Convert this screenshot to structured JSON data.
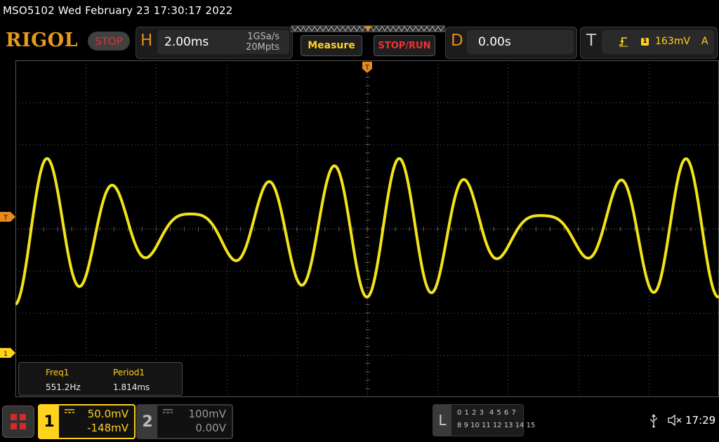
{
  "status_bar": {
    "text": "MSO5102  Wed February 23 17:30:17 2022"
  },
  "header": {
    "brand": "RIGOL",
    "run_state": "STOP",
    "horizontal": {
      "letter": "H",
      "timebase": "2.00ms",
      "sample_rate": "1GSa/s",
      "memory_depth": "20Mpts"
    },
    "measure_label": "Measure",
    "stop_run_label": "STOP/RUN",
    "delay": {
      "letter": "D",
      "value": "0.00s"
    },
    "trigger": {
      "letter": "T",
      "source": "1",
      "level": "163mV",
      "mode": "A"
    }
  },
  "screen": {
    "trigger_marker_label": "T",
    "channel1_marker_label": "1",
    "trace_color": "#ffef1a"
  },
  "measurements": [
    {
      "label": "Freq1",
      "value": "551.2Hz"
    },
    {
      "label": "Period1",
      "value": "1.814ms"
    }
  ],
  "channels": [
    {
      "number": "1",
      "scale": "50.0mV",
      "offset": "-148mV",
      "color": "#ffd21e",
      "active": true
    },
    {
      "number": "2",
      "scale": "100mV",
      "offset": "0.00V",
      "color": "#999999",
      "active": false
    }
  ],
  "logic": {
    "letter": "L",
    "row1": "0 1 2 3  4 5 6 7",
    "row2": "8 9 10 11 12 13 14 15"
  },
  "system": {
    "time": "17:29"
  }
}
